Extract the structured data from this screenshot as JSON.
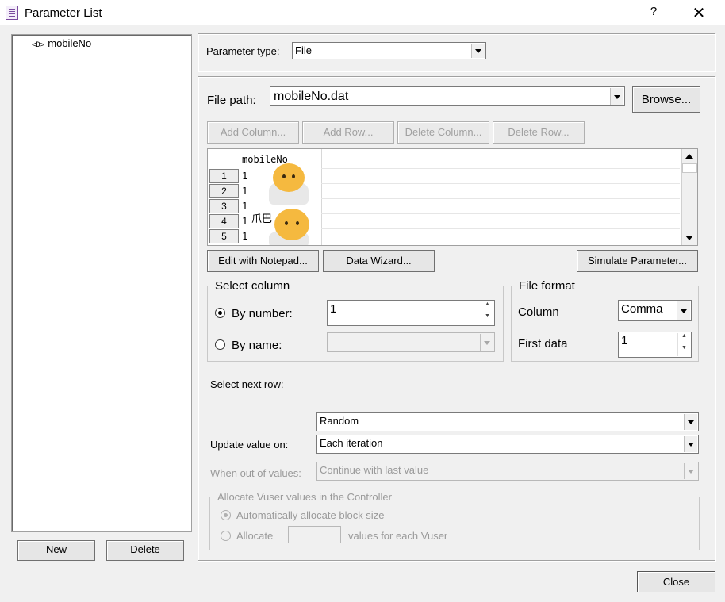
{
  "window": {
    "title": "Parameter List",
    "help_label": "?",
    "close_glyph": "✕"
  },
  "tree": {
    "items": [
      {
        "tag": "<D>",
        "label": "mobileNo"
      }
    ]
  },
  "left_buttons": {
    "new": "New",
    "delete": "Delete"
  },
  "param_type": {
    "label": "Parameter type:",
    "value": "File"
  },
  "file_path": {
    "label": "File path:",
    "value": "mobileNo.dat",
    "browse": "Browse..."
  },
  "table_buttons": {
    "add_column": "Add Column...",
    "add_row": "Add Row...",
    "delete_column": "Delete Column...",
    "delete_row": "Delete Row..."
  },
  "table": {
    "column_header": "mobileNo",
    "rows": [
      {
        "num": "1",
        "val": "1"
      },
      {
        "num": "2",
        "val": "1"
      },
      {
        "num": "3",
        "val": "1"
      },
      {
        "num": "4",
        "val": "1"
      },
      {
        "num": "5",
        "val": "1"
      }
    ],
    "sticker_caption": "爪巴"
  },
  "action_buttons": {
    "edit_notepad": "Edit with Notepad...",
    "data_wizard": "Data Wizard...",
    "simulate": "Simulate Parameter..."
  },
  "select_column": {
    "title": "Select column",
    "by_number_label": "By number:",
    "by_number_value": "1",
    "by_name_label": "By name:",
    "by_name_value": "",
    "selected": "by_number"
  },
  "file_format": {
    "title": "File format",
    "column_label": "Column",
    "column_value": "Comma",
    "first_data_label": "First data",
    "first_data_value": "1"
  },
  "select_next_row": {
    "label": "Select next row:",
    "value": "Random"
  },
  "update_value": {
    "label": "Update value on:",
    "value": "Each iteration"
  },
  "out_of_values": {
    "label": "When out of values:",
    "value": "Continue with last value"
  },
  "allocate": {
    "title": "Allocate Vuser values in the Controller",
    "auto_label": "Automatically allocate block size",
    "manual_label": "Allocate",
    "manual_suffix": "values for each Vuser",
    "manual_value": "",
    "selected": "auto"
  },
  "footer": {
    "close": "Close"
  }
}
